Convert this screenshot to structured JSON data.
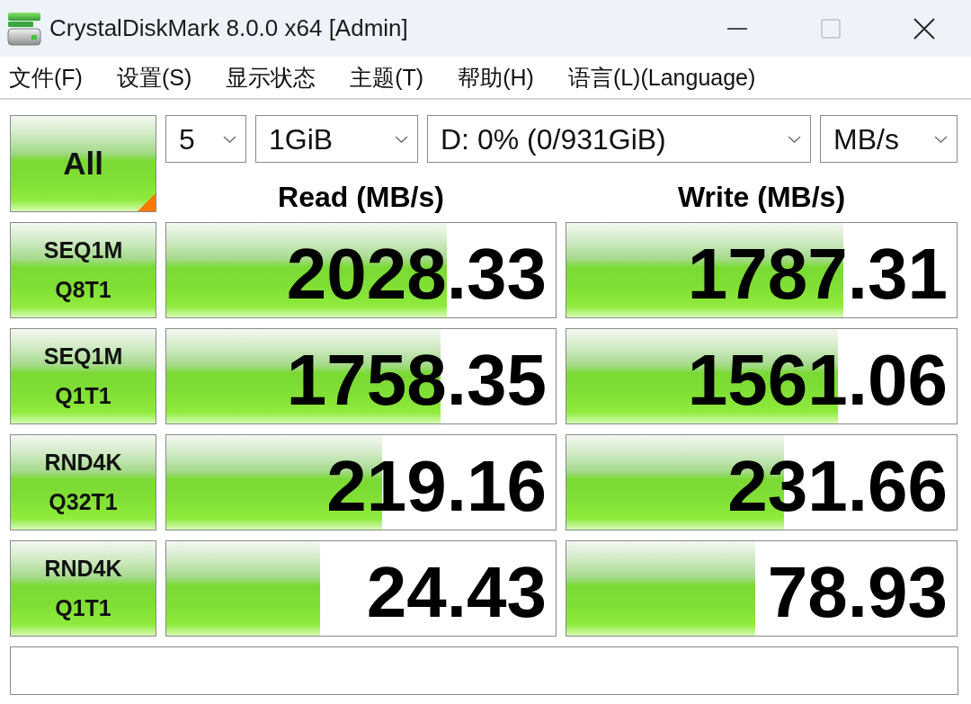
{
  "window": {
    "title": "CrystalDiskMark 8.0.0 x64 [Admin]",
    "controls": [
      {
        "kind": "minimize",
        "disabled": false
      },
      {
        "kind": "maximize",
        "disabled": true
      },
      {
        "kind": "close",
        "disabled": false
      }
    ]
  },
  "menu": [
    "文件(F)",
    "设置(S)",
    "显示状态",
    "主题(T)",
    "帮助(H)",
    "语言(L)(Language)"
  ],
  "all_button": "All",
  "settings": [
    {
      "kind": "count",
      "value": "5"
    },
    {
      "kind": "size",
      "value": "1GiB"
    },
    {
      "kind": "drive",
      "value": "D: 0% (0/931GiB)"
    },
    {
      "kind": "unit",
      "value": "MB/s"
    }
  ],
  "columns": [
    "Read (MB/s)",
    "Write (MB/s)"
  ],
  "tests": [
    {
      "name": "SEQ1M",
      "params": "Q8T1",
      "read": {
        "reading": "2028.33",
        "level": 0.72
      },
      "write": {
        "reading": "1787.31",
        "level": 0.71
      }
    },
    {
      "name": "SEQ1M",
      "params": "Q1T1",
      "read": {
        "reading": "1758.35",
        "level": 0.705
      },
      "write": {
        "reading": "1561.06",
        "level": 0.697
      }
    },
    {
      "name": "RND4K",
      "params": "Q32T1",
      "read": {
        "reading": "219.16",
        "level": 0.555
      },
      "write": {
        "reading": "231.66",
        "level": 0.557
      }
    },
    {
      "name": "RND4K",
      "params": "Q1T1",
      "read": {
        "reading": "24.43",
        "level": 0.394
      },
      "write": {
        "reading": "78.93",
        "level": 0.485
      }
    }
  ]
}
